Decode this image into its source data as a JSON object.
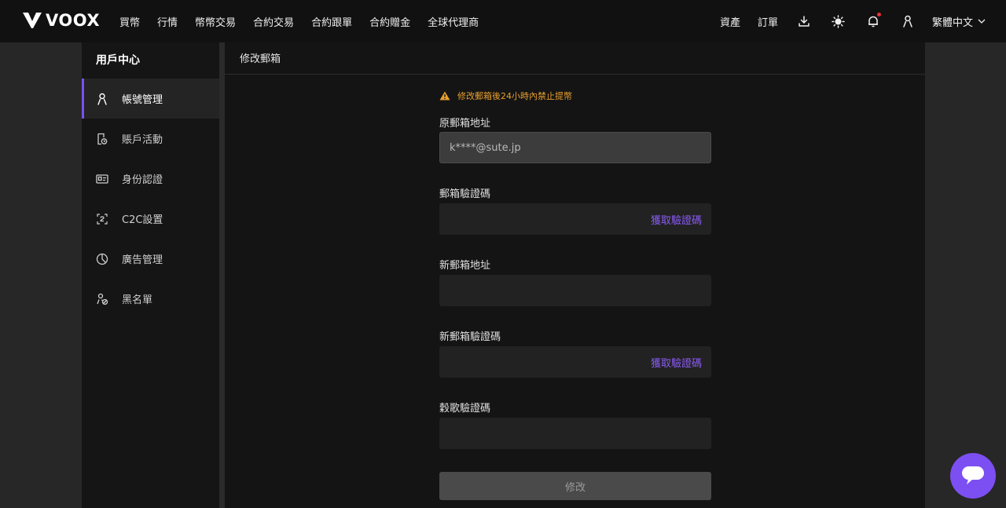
{
  "brand": {
    "name": "VOOX"
  },
  "nav": {
    "items": [
      "買幣",
      "行情",
      "幣幣交易",
      "合約交易",
      "合約跟單",
      "合約贈金",
      "全球代理商"
    ],
    "assets_label": "資產",
    "orders_label": "訂單",
    "language_label": "繁體中文"
  },
  "sidebar": {
    "title": "用戶中心",
    "items": [
      {
        "label": "帳號管理",
        "icon": "user-icon",
        "active": true
      },
      {
        "label": "賬戶活動",
        "icon": "activity-icon"
      },
      {
        "label": "身份認證",
        "icon": "id-card-icon"
      },
      {
        "label": "C2C設置",
        "icon": "c2c-icon"
      },
      {
        "label": "廣告管理",
        "icon": "pie-chart-icon"
      },
      {
        "label": "黑名單",
        "icon": "blacklist-icon"
      }
    ]
  },
  "main": {
    "title": "修改郵箱",
    "warning": "修改郵箱後24小時內禁止提幣",
    "fields": {
      "old_email_label": "原郵箱地址",
      "old_email_value": "k****@sute.jp",
      "email_code_label": "郵箱驗證碼",
      "get_code_label": "獲取驗證碼",
      "new_email_label": "新郵箱地址",
      "new_email_code_label": "新郵箱驗證碼",
      "new_get_code_label": "獲取驗證碼",
      "google_code_label": "穀歌驗證碼"
    },
    "submit_label": "修改"
  },
  "colors": {
    "accent": "#7c4ff2",
    "warning": "#e79e2e",
    "notification": "#e8313a"
  }
}
